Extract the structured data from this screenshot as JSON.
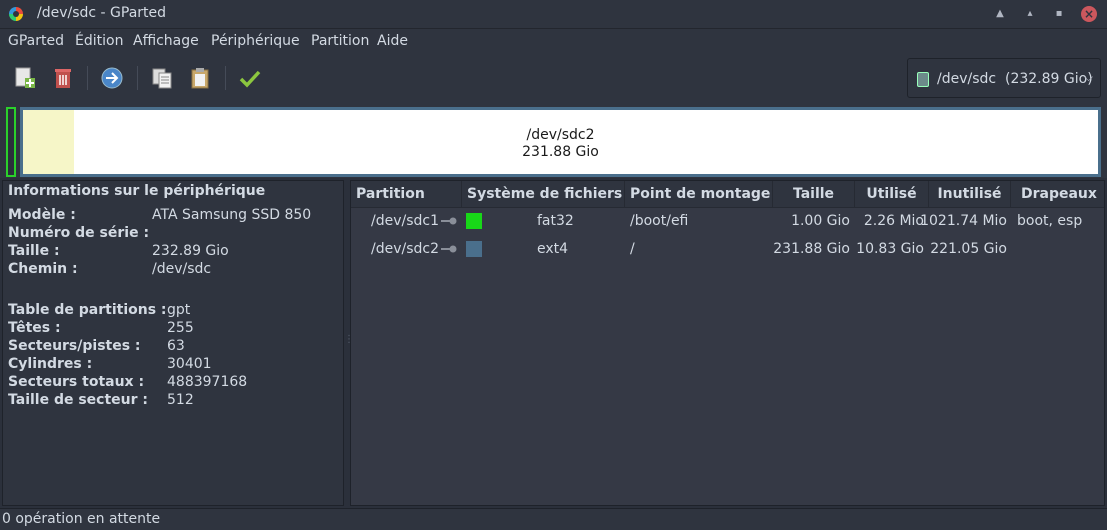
{
  "window": {
    "title": "/dev/sdc - GParted"
  },
  "menu": [
    "GParted",
    "Édition",
    "Affichage",
    "Périphérique",
    "Partition",
    "Aide"
  ],
  "toolbar": {
    "buttons": [
      "new-partition-icon",
      "delete-icon",
      "resize-move-icon",
      "copy-icon",
      "paste-icon",
      "apply-icon"
    ],
    "device_label": "/dev/sdc  (232.89 Gio)"
  },
  "diskmap": {
    "partition_name": "/dev/sdc2",
    "partition_size": "231.88 Gio",
    "used_fraction": 0.047
  },
  "info": {
    "title": "Informations sur le périphérique",
    "rows": [
      {
        "k": "Modèle :",
        "v": "ATA Samsung SSD 850"
      },
      {
        "k": "Numéro de série :",
        "v": ""
      },
      {
        "k": "Taille :",
        "v": "232.89 Gio"
      },
      {
        "k": "Chemin :",
        "v": "/dev/sdc"
      },
      {
        "k": "Table de partitions :",
        "v": "gpt"
      },
      {
        "k": "Têtes :",
        "v": "255"
      },
      {
        "k": "Secteurs/pistes :",
        "v": "63"
      },
      {
        "k": "Cylindres :",
        "v": "30401"
      },
      {
        "k": "Secteurs totaux :",
        "v": "488397168"
      },
      {
        "k": "Taille de secteur :",
        "v": "512"
      }
    ]
  },
  "table": {
    "headers": [
      "Partition",
      "Système de fichiers",
      "Point de montage",
      "Taille",
      "Utilisé",
      "Inutilisé",
      "Drapeaux"
    ],
    "rows": [
      {
        "partition": "/dev/sdc1",
        "fs": "fat32",
        "fs_color": "#18d818",
        "mount": "/boot/efi",
        "size": "1.00 Gio",
        "used": "2.26 Mio",
        "unused": "1021.74 Mio",
        "flags": "boot, esp"
      },
      {
        "partition": "/dev/sdc2",
        "fs": "ext4",
        "fs_color": "#4a6f8c",
        "mount": "/",
        "size": "231.88 Gio",
        "used": "10.83 Gio",
        "unused": "221.05 Gio",
        "flags": ""
      }
    ]
  },
  "status": {
    "text": "0 opération en attente"
  }
}
